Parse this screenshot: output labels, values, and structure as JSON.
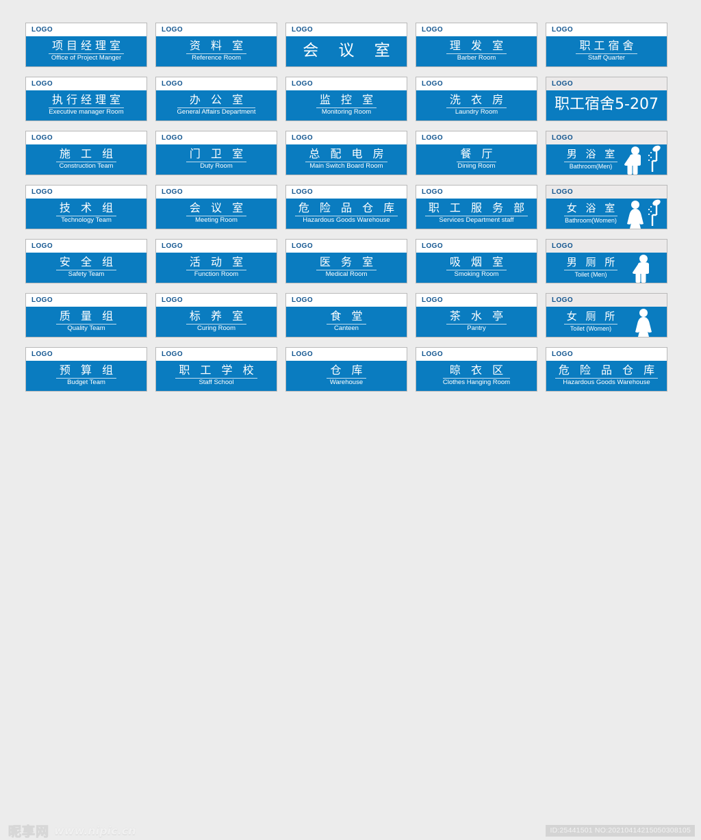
{
  "page": {
    "background_color": "#ececec",
    "sign_blue": "#0a7cc0",
    "logo_color": "#12558f",
    "logo_label": "LOGO"
  },
  "watermark": {
    "site_cn": "昵享网",
    "site_url": "www.nipic.cn",
    "id_text": "ID:25441501 NO:20210414215050308105"
  },
  "signs": [
    {
      "logo": "LOGO",
      "cn": "项目经理室",
      "en": "Office of Project Manger",
      "style": "normal",
      "icon": ""
    },
    {
      "logo": "LOGO",
      "cn": "资 料 室",
      "en": "Reference Room",
      "style": "normal",
      "icon": ""
    },
    {
      "logo": "LOGO",
      "cn": "会 议 室",
      "en": "",
      "style": "big",
      "icon": ""
    },
    {
      "logo": "LOGO",
      "cn": "理 发 室",
      "en": "Barber Room",
      "style": "normal",
      "icon": ""
    },
    {
      "logo": "LOGO",
      "cn": "职工宿舍",
      "en": "Staff Quarter",
      "style": "normal",
      "icon": ""
    },
    {
      "logo": "LOGO",
      "cn": "执行经理室",
      "en": "Executive manager Room",
      "style": "normal",
      "icon": ""
    },
    {
      "logo": "LOGO",
      "cn": "办 公 室",
      "en": "General Affairs Department",
      "style": "normal",
      "icon": ""
    },
    {
      "logo": "LOGO",
      "cn": "监 控 室",
      "en": "Monitoring Room",
      "style": "normal",
      "icon": ""
    },
    {
      "logo": "LOGO",
      "cn": "洗 衣 房",
      "en": "Laundry Room",
      "style": "normal",
      "icon": ""
    },
    {
      "logo": "LOGO",
      "cn": "职工宿舍5-207",
      "en": "",
      "style": "bigtight head-gray",
      "icon": ""
    },
    {
      "logo": "LOGO",
      "cn": "施 工 组",
      "en": "Construction Team",
      "style": "normal",
      "icon": ""
    },
    {
      "logo": "LOGO",
      "cn": "门 卫 室",
      "en": "Duty Room",
      "style": "normal",
      "icon": ""
    },
    {
      "logo": "LOGO",
      "cn": "总 配 电 房",
      "en": "Main Switch Board Room",
      "style": "normal",
      "icon": ""
    },
    {
      "logo": "LOGO",
      "cn": "餐 厅",
      "en": "Dining Room",
      "style": "normal",
      "icon": ""
    },
    {
      "logo": "LOGO",
      "cn": "男 浴 室",
      "en": "Bathroom(Men)",
      "style": "with-icon head-gray",
      "icon": "shower-man-icon"
    },
    {
      "logo": "LOGO",
      "cn": "技 术 组",
      "en": "Technology Team",
      "style": "normal",
      "icon": ""
    },
    {
      "logo": "LOGO",
      "cn": "会 议 室",
      "en": "Meeting Room",
      "style": "normal",
      "icon": ""
    },
    {
      "logo": "LOGO",
      "cn": "危 险 品 仓 库",
      "en": "Hazardous Goods Warehouse",
      "style": "normal",
      "icon": ""
    },
    {
      "logo": "LOGO",
      "cn": "职 工 服 务 部",
      "en": "Services Department staff",
      "style": "normal",
      "icon": ""
    },
    {
      "logo": "LOGO",
      "cn": "女 浴 室",
      "en": "Bathroom(Women)",
      "style": "with-icon head-gray",
      "icon": "shower-woman-icon"
    },
    {
      "logo": "LOGO",
      "cn": "安 全 组",
      "en": "Safety Team",
      "style": "normal",
      "icon": ""
    },
    {
      "logo": "LOGO",
      "cn": "活 动 室",
      "en": "Function Room",
      "style": "normal",
      "icon": ""
    },
    {
      "logo": "LOGO",
      "cn": "医 务 室",
      "en": "Medical Room",
      "style": "normal",
      "icon": ""
    },
    {
      "logo": "LOGO",
      "cn": "吸 烟 室",
      "en": "Smoking Room",
      "style": "normal",
      "icon": ""
    },
    {
      "logo": "LOGO",
      "cn": "男 厕 所",
      "en": "Toilet (Men)",
      "style": "with-icon head-gray",
      "icon": "man-icon"
    },
    {
      "logo": "LOGO",
      "cn": "质 量 组",
      "en": "Quality Team",
      "style": "normal",
      "icon": ""
    },
    {
      "logo": "LOGO",
      "cn": "标 养 室",
      "en": "Curing Room",
      "style": "normal",
      "icon": ""
    },
    {
      "logo": "LOGO",
      "cn": "食 堂",
      "en": "Canteen",
      "style": "normal",
      "icon": ""
    },
    {
      "logo": "LOGO",
      "cn": "茶 水 亭",
      "en": "Pantry",
      "style": "normal",
      "icon": ""
    },
    {
      "logo": "LOGO",
      "cn": "女 厕 所",
      "en": "Toilet (Women)",
      "style": "with-icon head-gray",
      "icon": "woman-icon"
    },
    {
      "logo": "LOGO",
      "cn": "预 算 组",
      "en": "Budget Team",
      "style": "normal",
      "icon": ""
    },
    {
      "logo": "LOGO",
      "cn": "职 工 学 校",
      "en": "Staff School",
      "style": "normal",
      "icon": ""
    },
    {
      "logo": "LOGO",
      "cn": "仓 库",
      "en": "Warehouse",
      "style": "normal",
      "icon": ""
    },
    {
      "logo": "LOGO",
      "cn": "晾 衣 区",
      "en": "Clothes Hanging Room",
      "style": "normal",
      "icon": ""
    },
    {
      "logo": "LOGO",
      "cn": "危 险 品 仓 库",
      "en": "Hazardous Goods Warehouse",
      "style": "normal",
      "icon": ""
    }
  ]
}
